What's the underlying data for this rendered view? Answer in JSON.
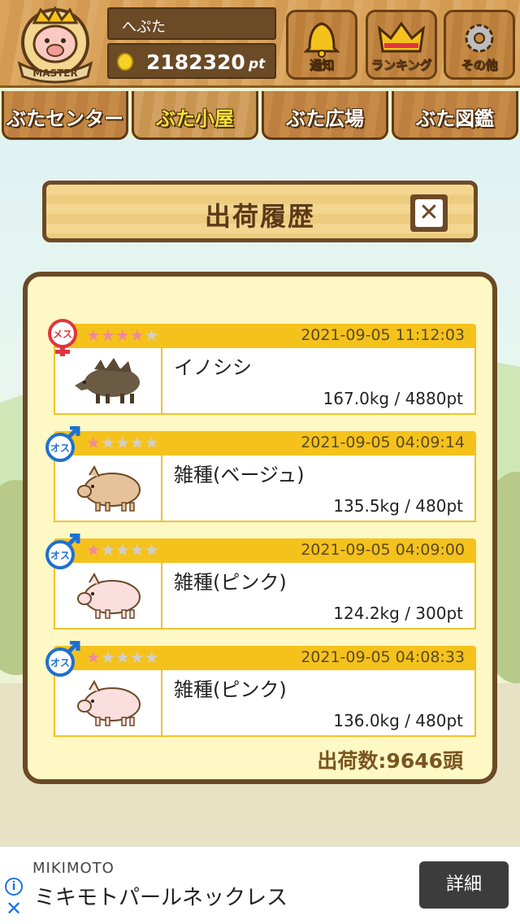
{
  "header": {
    "avatar_badge": "MASTER",
    "user_name": "へぷた",
    "points": "2182320",
    "points_unit": "pt",
    "buttons": [
      {
        "label": "通知",
        "icon": "bell-icon"
      },
      {
        "label": "ランキング",
        "icon": "crown-icon"
      },
      {
        "label": "その他",
        "icon": "gear-icon"
      }
    ]
  },
  "tabs": [
    {
      "label": "ぶたセンター",
      "active": false
    },
    {
      "label": "ぶた小屋",
      "active": true
    },
    {
      "label": "ぶた広場",
      "active": false
    },
    {
      "label": "ぶた図鑑",
      "active": false
    }
  ],
  "dialog": {
    "title": "出荷履歴",
    "close_label": "✕",
    "entries": [
      {
        "gender": "メス",
        "stars": 4,
        "date": "2021-09-05 11:12:03",
        "name": "イノシシ",
        "weight": "167.0kg / 4880pt"
      },
      {
        "gender": "オス",
        "stars": 1,
        "date": "2021-09-05 04:09:14",
        "name": "雑種(ベージュ)",
        "weight": "135.5kg / 480pt"
      },
      {
        "gender": "オス",
        "stars": 1,
        "date": "2021-09-05 04:09:00",
        "name": "雑種(ピンク)",
        "weight": "124.2kg / 300pt"
      },
      {
        "gender": "オス",
        "stars": 1,
        "date": "2021-09-05 04:08:33",
        "name": "雑種(ピンク)",
        "weight": "136.0kg / 480pt"
      }
    ],
    "shipped_count": "出荷数:9646頭"
  },
  "ad": {
    "brand": "MIKIMOTO",
    "title": "ミキモトパールネックレス",
    "button": "詳細",
    "info": "i",
    "close": "✕"
  },
  "colors": {
    "wood_dark": "#6b4a26",
    "entry_bar": "#f5c21c",
    "star_on": "#f08a9a",
    "star_off": "#cfcfcf",
    "female": "#e0353e",
    "male": "#1f6fd0"
  }
}
